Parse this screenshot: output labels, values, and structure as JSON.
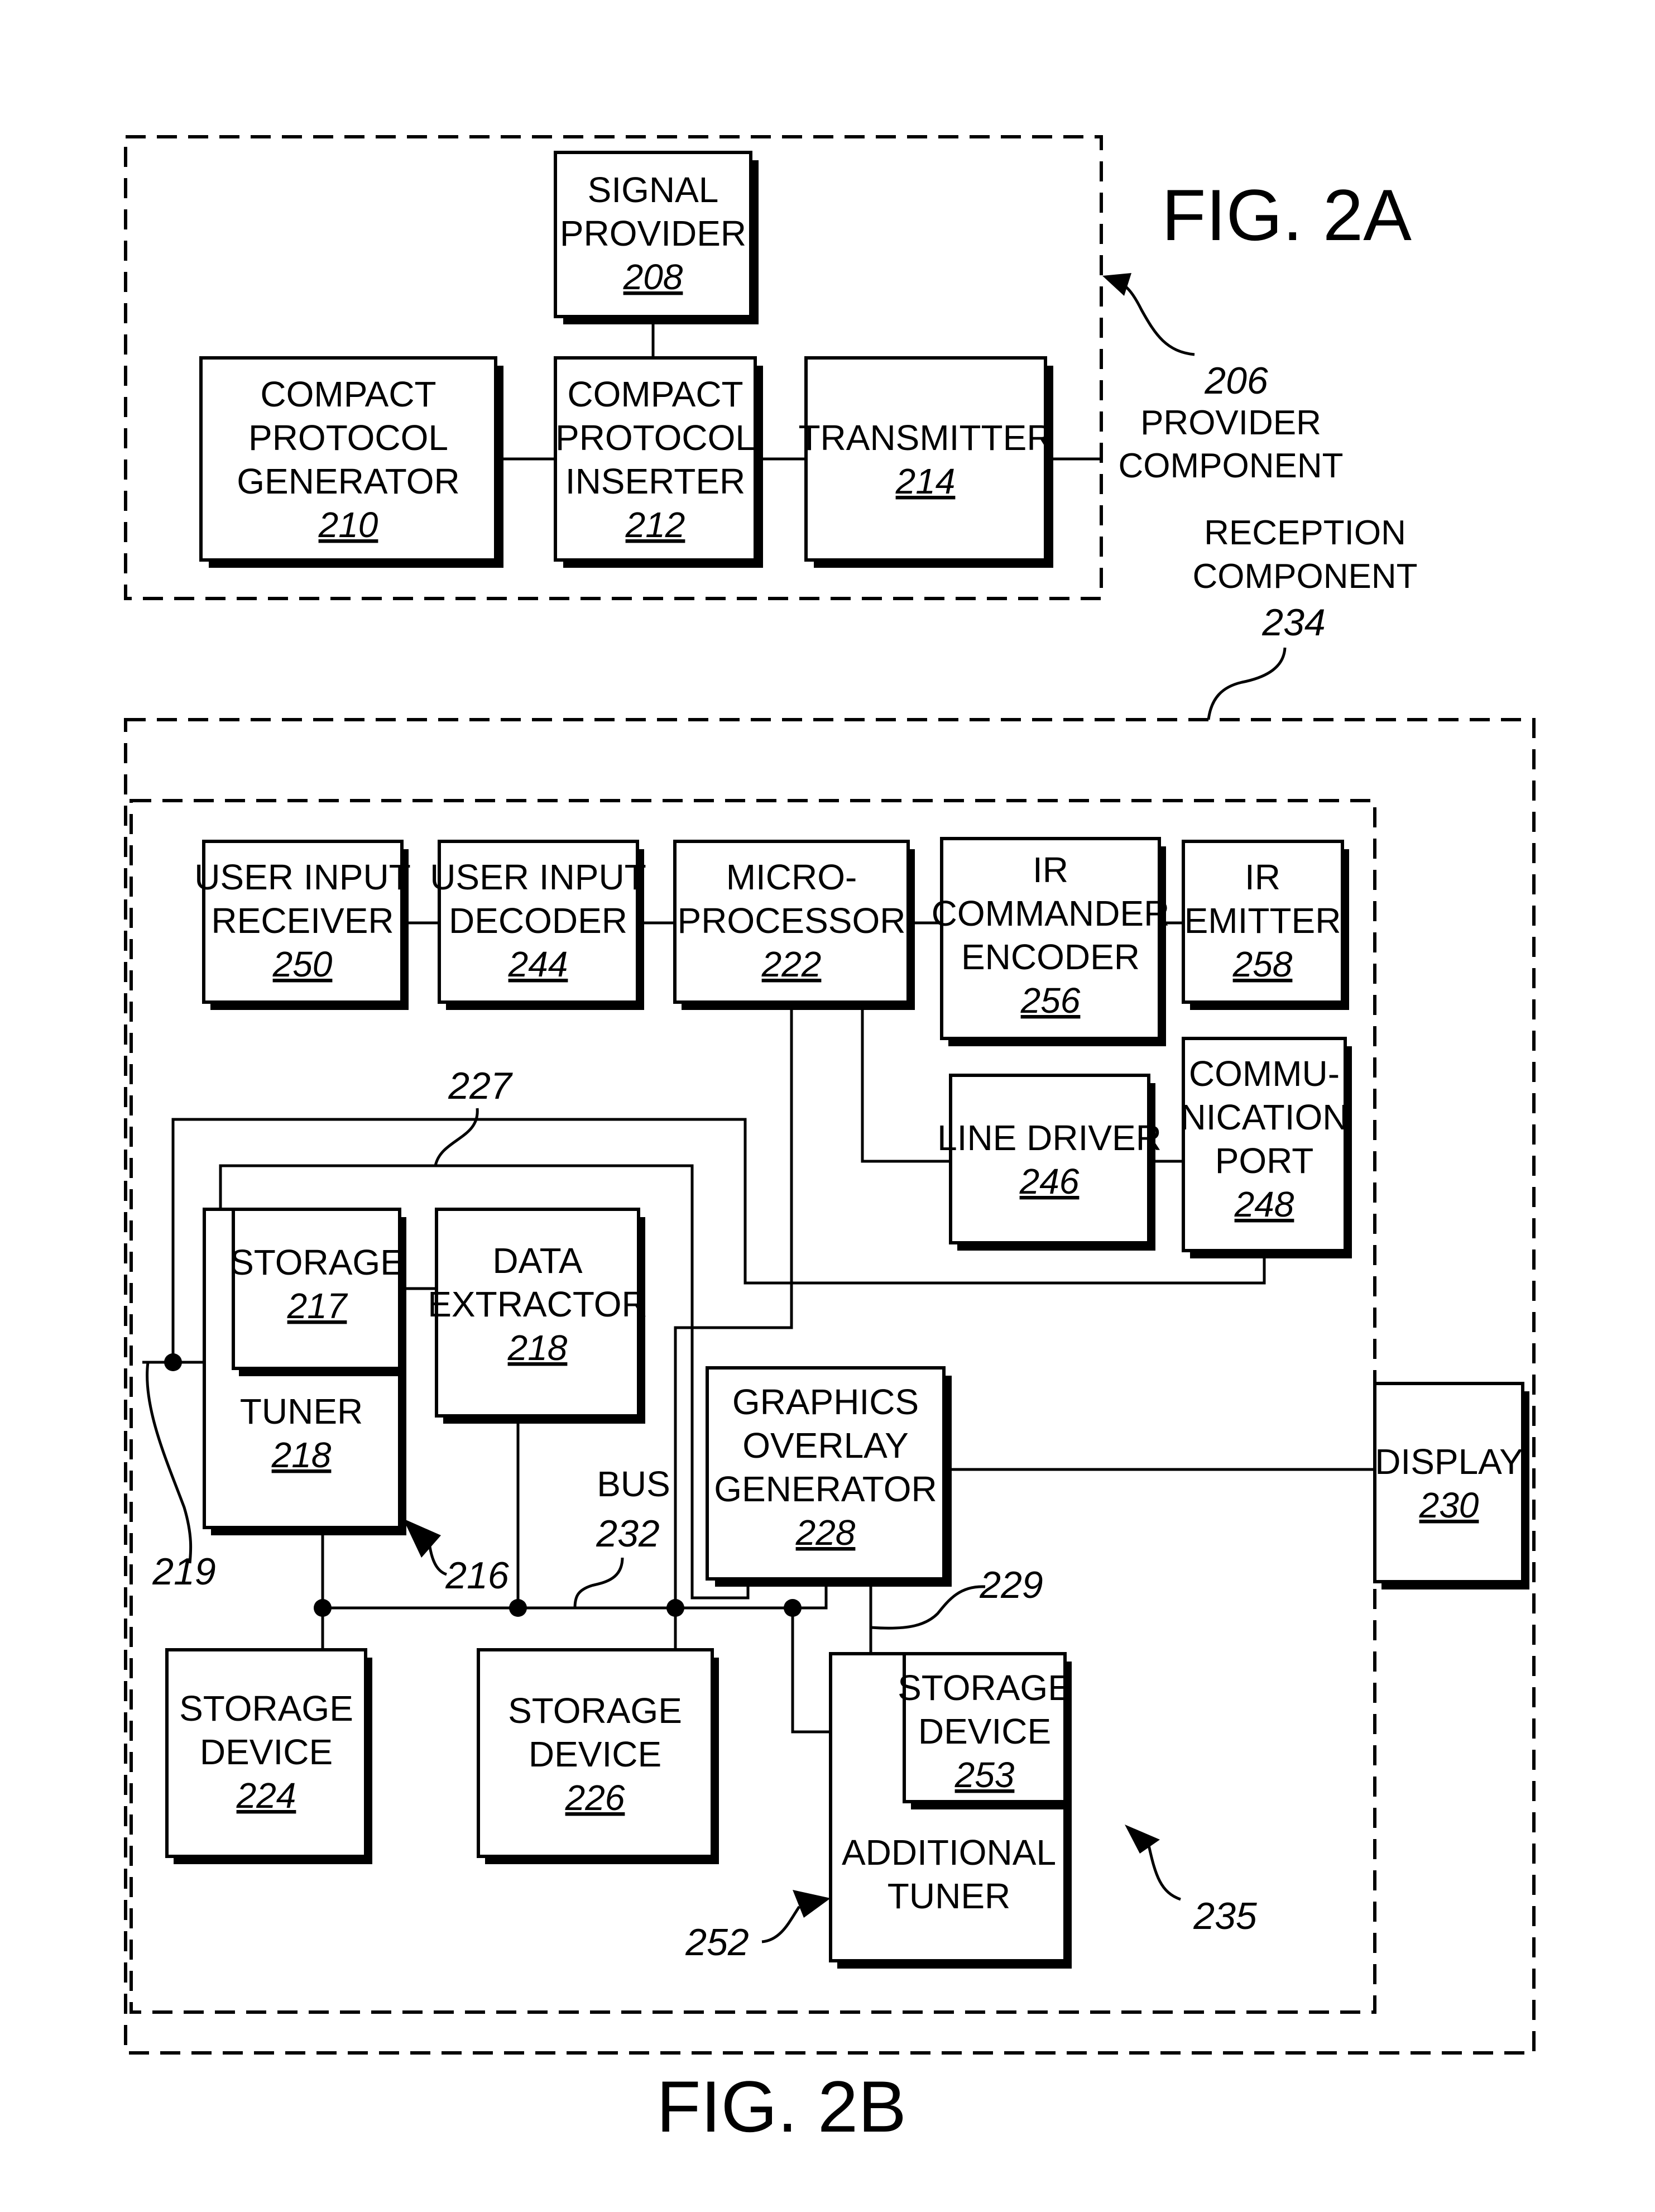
{
  "fig_2a": {
    "title": "FIG. 2A",
    "provider_ref": "206",
    "provider_caption": [
      "PROVIDER",
      "COMPONENT"
    ],
    "blocks": {
      "signal_provider": {
        "lines": [
          "SIGNAL",
          "PROVIDER"
        ],
        "num": "208"
      },
      "cp_generator": {
        "lines": [
          "COMPACT",
          "PROTOCOL",
          "GENERATOR"
        ],
        "num": "210"
      },
      "cp_inserter": {
        "lines": [
          "COMPACT",
          "PROTOCOL",
          "INSERTER"
        ],
        "num": "212"
      },
      "transmitter": {
        "lines": [
          "TRANSMITTER"
        ],
        "num": "214"
      }
    }
  },
  "fig_2b": {
    "title": "FIG. 2B",
    "reception_caption": [
      "RECEPTION",
      "COMPONENT"
    ],
    "reception_ref": "234",
    "blocks": {
      "user_input_receiver": {
        "lines": [
          "USER INPUT",
          "RECEIVER"
        ],
        "num": "250"
      },
      "user_input_decoder": {
        "lines": [
          "USER INPUT",
          "DECODER"
        ],
        "num": "244"
      },
      "microprocessor": {
        "lines": [
          "MICRO-",
          "PROCESSOR"
        ],
        "num": "222"
      },
      "ir_commander_encoder": {
        "lines": [
          "IR",
          "COMMANDER",
          "ENCODER"
        ],
        "num": "256"
      },
      "ir_emitter": {
        "lines": [
          "IR",
          "EMITTER"
        ],
        "num": "258"
      },
      "line_driver": {
        "lines": [
          "LINE DRIVER"
        ],
        "num": "246"
      },
      "communication_port": {
        "lines": [
          "COMMU-",
          "NICATION",
          "PORT"
        ],
        "num": "248"
      },
      "storage_217": {
        "lines": [
          "STORAGE"
        ],
        "num": "217"
      },
      "tuner": {
        "lines": [
          "TUNER"
        ],
        "num": "218"
      },
      "data_extractor": {
        "lines": [
          "DATA",
          "EXTRACTOR"
        ],
        "num": "218"
      },
      "graphics_overlay": {
        "lines": [
          "GRAPHICS",
          "OVERLAY",
          "GENERATOR"
        ],
        "num": "228"
      },
      "display": {
        "lines": [
          "DISPLAY"
        ],
        "num": "230"
      },
      "storage_224": {
        "lines": [
          "STORAGE",
          "DEVICE"
        ],
        "num": "224"
      },
      "storage_226": {
        "lines": [
          "STORAGE",
          "DEVICE"
        ],
        "num": "226"
      },
      "storage_253": {
        "lines": [
          "STORAGE",
          "DEVICE"
        ],
        "num": "253"
      },
      "additional_tuner": {
        "lines": [
          "ADDITIONAL",
          "TUNER"
        ],
        "num": ""
      }
    },
    "bus_label": "BUS",
    "bus_ref": "232",
    "refs": {
      "r227": "227",
      "r219": "219",
      "r216": "216",
      "r229": "229",
      "r252": "252",
      "r235": "235"
    }
  }
}
